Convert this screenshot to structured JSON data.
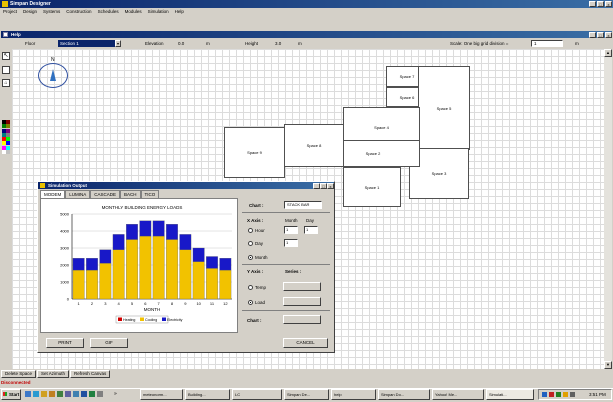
{
  "app": {
    "title": "Simpan Designer",
    "menu": [
      "Project",
      "Design",
      "Systems",
      "Construction",
      "Schedules",
      "Modules",
      "Simulation",
      "Help"
    ],
    "inner_title": "Help"
  },
  "floorbar": {
    "floor_label": "Floor",
    "floor_value": "Section 1",
    "elevation_label": "Elevation",
    "elevation_value": "0.0",
    "elevation_unit": "m",
    "height_label": "Height",
    "height_value": "3.0",
    "height_unit": "m",
    "scale_label": "Scale: One big grid division =",
    "scale_value": "1",
    "scale_unit": "m"
  },
  "compass": {
    "north_label": "N"
  },
  "spaces": [
    "Space 7",
    "Space 6",
    "Space 5",
    "Space 4",
    "Space 3",
    "Space 2",
    "Space 1",
    "Space 8",
    "Space 9"
  ],
  "sim": {
    "title": "Simulation Output",
    "tabs": [
      "MODEM",
      "LUMINA",
      "CASCADE",
      "BACH",
      "TICO"
    ],
    "chart_field_label": "Chart :",
    "chart_type_value": "STACK BAR",
    "xaxis_label": "X Axis :",
    "month_label": "Month",
    "day_label": "Day",
    "month_value": "1",
    "day_value": "1",
    "hour_label": "Hour",
    "day_radio_label": "Day",
    "day_select_value": "1",
    "month_radio_label": "Month",
    "yaxis_label": "Y Axis :",
    "series_label": "Series :",
    "temp_label": "Temp",
    "load_label": "Load",
    "chart_bottom_label": "Chart :",
    "print_label": "PRINT",
    "gif_label": "GIF",
    "cancel_label": "CANCEL"
  },
  "chart_data": {
    "type": "bar",
    "stacked": true,
    "title": "MONTHLY BUILDING ENERGY LOADS",
    "xlabel": "MONTH",
    "ylabel": "",
    "categories": [
      "1",
      "2",
      "3",
      "4",
      "5",
      "6",
      "7",
      "8",
      "9",
      "10",
      "11",
      "12"
    ],
    "ylim": [
      0,
      5000
    ],
    "yticks": [
      "5000",
      "4000",
      "3000",
      "2000",
      "1000",
      "0"
    ],
    "series": [
      {
        "name": "Heating",
        "color": "#d00000",
        "values": [
          0,
          0,
          0,
          0,
          0,
          0,
          0,
          0,
          0,
          0,
          0,
          0
        ]
      },
      {
        "name": "Cooling",
        "color": "#f2c200",
        "values": [
          1700,
          1700,
          2100,
          2900,
          3500,
          3700,
          3700,
          3500,
          2900,
          2200,
          1800,
          1700
        ]
      },
      {
        "name": "Electricity",
        "color": "#1818c8",
        "values": [
          700,
          700,
          800,
          900,
          900,
          900,
          900,
          900,
          900,
          800,
          700,
          700
        ]
      }
    ]
  },
  "bottom_buttons": [
    "Delete Space",
    "Set Azimuth",
    "Refresh Canvas"
  ],
  "status": {
    "text": "Disconnected"
  },
  "taskbar": {
    "start_label": "Start",
    "items": [
      "meteonorm...",
      "Building...",
      "LC",
      "Simpan De...",
      "help",
      "Simpan Do...",
      "Yahoo! Me...",
      "Simulati..."
    ],
    "clock": "3:51 PM"
  },
  "colors": {
    "title_dark": "#0a246a",
    "title_light": "#3a6ea5",
    "face": "#d4d0c8",
    "status_red": "#c00000"
  },
  "palette_colors": [
    "#000000",
    "#800000",
    "#008000",
    "#808000",
    "#000080",
    "#800080",
    "#008080",
    "#808080",
    "#ff0000",
    "#00ff00",
    "#ffff00",
    "#0000ff",
    "#ff00ff",
    "#00ffff",
    "#ffffff",
    "#c0c0c0"
  ]
}
